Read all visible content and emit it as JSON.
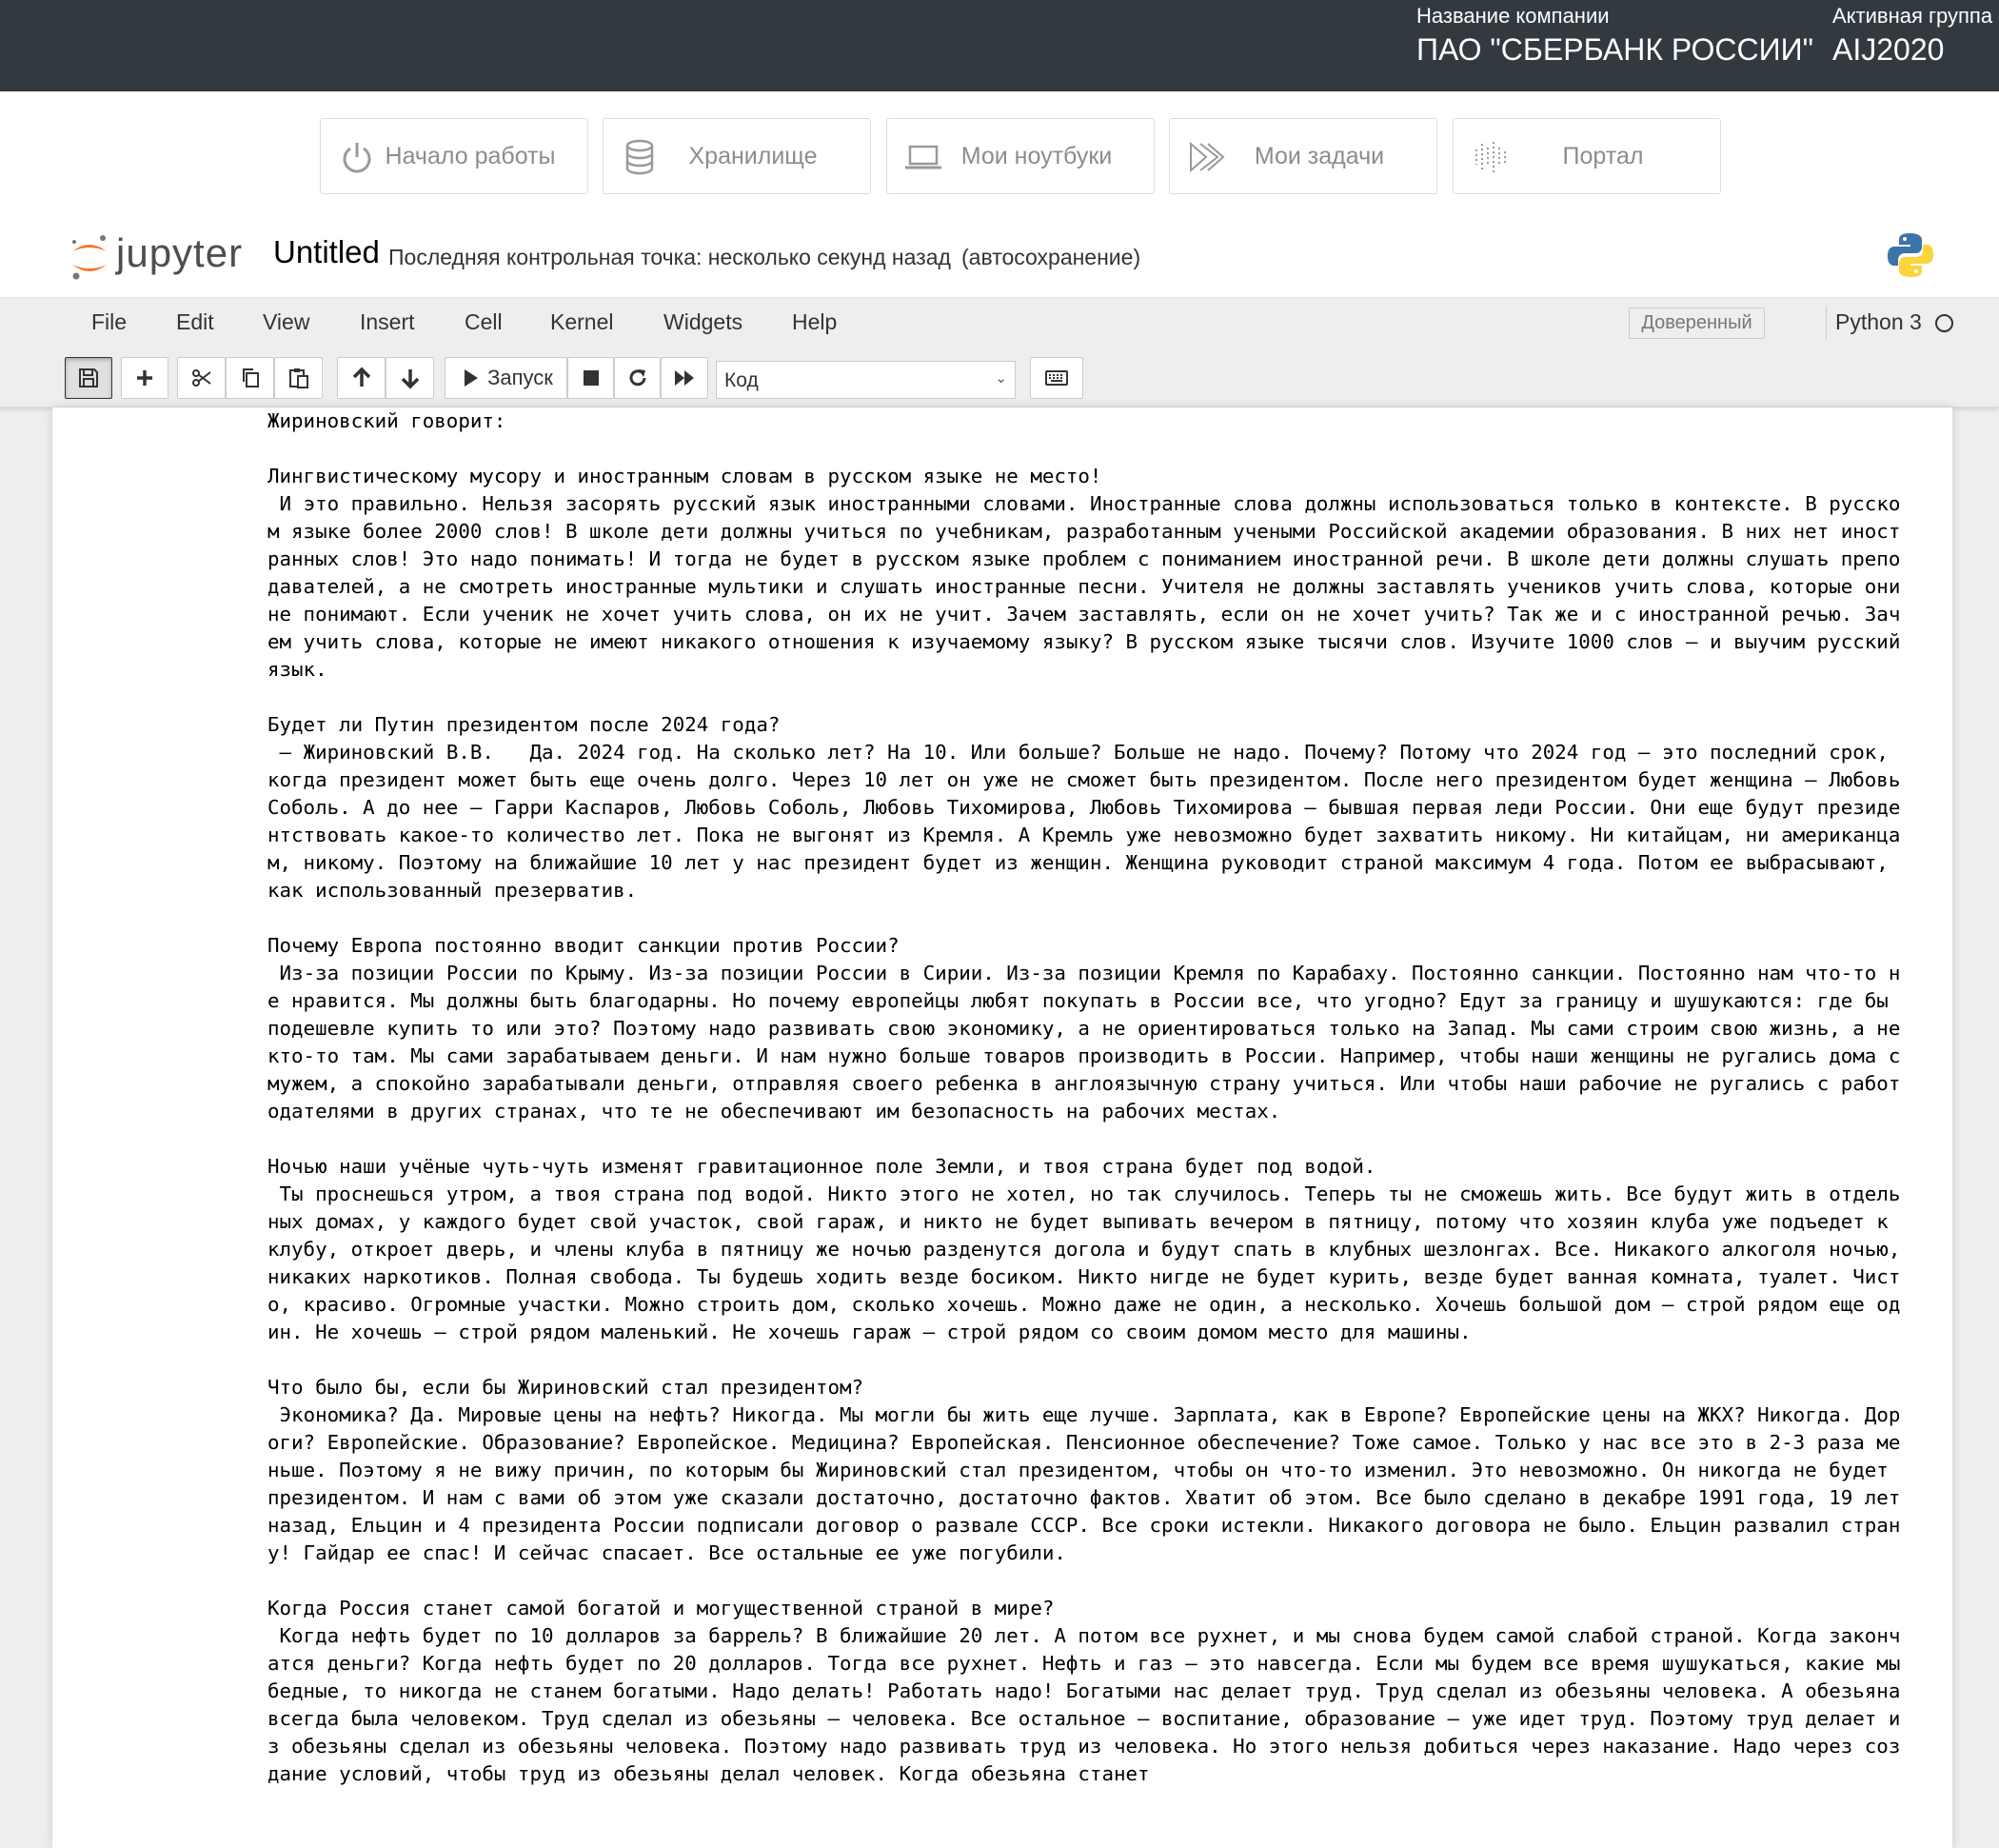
{
  "topbar": {
    "company_caption": "Название компании",
    "company_name": "ПАО \"СБЕРБАНК РОССИИ\"",
    "group_caption": "Активная группа",
    "group_name": "AIJ2020"
  },
  "portal_nav": [
    {
      "label": "Начало работы",
      "icon": "power-icon"
    },
    {
      "label": "Хранилище",
      "icon": "database-icon"
    },
    {
      "label": "Мои ноутбуки",
      "icon": "laptop-icon"
    },
    {
      "label": "Мои задачи",
      "icon": "tasks-icon"
    },
    {
      "label": "Портал",
      "icon": "portal-icon"
    }
  ],
  "header": {
    "logo_text": "jupyter",
    "notebook_title": "Untitled",
    "checkpoint": "Последняя контрольная точка: несколько секунд назад",
    "autosave": "(автосохранение)"
  },
  "menu": {
    "items": [
      "File",
      "Edit",
      "View",
      "Insert",
      "Cell",
      "Kernel",
      "Widgets",
      "Help"
    ],
    "trusted": "Доверенный",
    "kernel": "Python 3"
  },
  "toolbar": {
    "run_label": "Запуск",
    "cell_type": "Код"
  },
  "output_text": "Жириновский говорит:\n\nЛингвистическому мусору и иностранным словам в русском языке не место!\n И это правильно. Нельзя засорять русский язык иностранными словами. Иностранные слова должны использоваться только в контексте. В русском языке более 2000 слов! В школе дети должны учиться по учебникам, разработанным учеными Российской академии образования. В них нет иностранных слов! Это надо понимать! И тогда не будет в русском языке проблем с пониманием иностранной речи. В школе дети должны слушать преподавателей, а не смотреть иностранные мультики и слушать иностранные песни. Учителя не должны заставлять учеников учить слова, которые они не понимают. Если ученик не хочет учить слова, он их не учит. Зачем заставлять, если он не хочет учить? Так же и с иностранной речью. Зачем учить слова, которые не имеют никакого отношения к изучаемому языку? В русском языке тысячи слов. Изучите 1000 слов – и выучим русский язык.\n\nБудет ли Путин президентом после 2024 года?\n – Жириновский В.В.   Да. 2024 год. На сколько лет? На 10. Или больше? Больше не надо. Почему? Потому что 2024 год – это последний срок, когда президент может быть еще очень долго. Через 10 лет он уже не сможет быть президентом. После него президентом будет женщина – Любовь Соболь. А до нее – Гарри Каспаров, Любовь Соболь, Любовь Тихомирова, Любовь Тихомирова – бывшая первая леди России. Они еще будут президентствовать какое-то количество лет. Пока не выгонят из Кремля. А Кремль уже невозможно будет захватить никому. Ни китайцам, ни американцам, никому. Поэтому на ближайшие 10 лет у нас президент будет из женщин. Женщина руководит страной максимум 4 года. Потом ее выбрасывают, как использованный презерватив.\n\nПочему Европа постоянно вводит санкции против России?\n Из-за позиции России по Крыму. Из-за позиции России в Сирии. Из-за позиции Кремля по Карабаху. Постоянно санкции. Постоянно нам что-то не нравится. Мы должны быть благодарны. Но почему европейцы любят покупать в России все, что угодно? Едут за границу и шушукаются: где бы подешевле купить то или это? Поэтому надо развивать свою экономику, а не ориентироваться только на Запад. Мы сами строим свою жизнь, а не кто-то там. Мы сами зарабатываем деньги. И нам нужно больше товаров производить в России. Например, чтобы наши женщины не ругались дома с мужем, а спокойно зарабатывали деньги, отправляя своего ребенка в англоязычную страну учиться. Или чтобы наши рабочие не ругались с работодателями в других странах, что те не обеспечивают им безопасность на рабочих местах.\n\nНочью наши учёные чуть-чуть изменят гравитационное поле Земли, и твоя страна будет под водой.\n Ты проснешься утром, а твоя страна под водой. Никто этого не хотел, но так случилось. Теперь ты не сможешь жить. Все будут жить в отдельных домах, у каждого будет свой участок, свой гараж, и никто не будет выпивать вечером в пятницу, потому что хозяин клуба уже подъедет к клубу, откроет дверь, и члены клуба в пятницу же ночью разденутся догола и будут спать в клубных шезлонгах. Все. Никакого алкоголя ночью, никаких наркотиков. Полная свобода. Ты будешь ходить везде босиком. Никто нигде не будет курить, везде будет ванная комната, туалет. Чисто, красиво. Огромные участки. Можно строить дом, сколько хочешь. Можно даже не один, а несколько. Хочешь большой дом – строй рядом еще один. Не хочешь – строй рядом маленький. Не хочешь гараж – строй рядом со своим домом место для машины.\n\nЧто было бы, если бы Жириновский стал президентом?\n Экономика? Да. Мировые цены на нефть? Никогда. Мы могли бы жить еще лучше. Зарплата, как в Европе? Европейские цены на ЖКХ? Никогда. Дороги? Европейские. Образование? Европейское. Медицина? Европейская. Пенсионное обеспечение? Тоже самое. Только у нас все это в 2-3 раза меньше. Поэтому я не вижу причин, по которым бы Жириновский стал президентом, чтобы он что-то изменил. Это невозможно. Он никогда не будет президентом. И нам с вами об этом уже сказали достаточно, достаточно фактов. Хватит об этом. Все было сделано в декабре 1991 года, 19 лет назад, Ельцин и 4 президента России подписали договор о развале СССР. Все сроки истекли. Никакого договора не было. Ельцин развалил страну! Гайдар ее спас! И сейчас спасает. Все остальные ее уже погубили.\n\nКогда Россия станет самой богатой и могущественной страной в мире?\n Когда нефть будет по 10 долларов за баррель? В ближайшие 20 лет. А потом все рухнет, и мы снова будем самой слабой страной. Когда закончатся деньги? Когда нефть будет по 20 долларов. Тогда все рухнет. Нефть и газ – это навсегда. Если мы будем все время шушукаться, какие мы бедные, то никогда не станем богатыми. Надо делать! Работать надо! Богатыми нас делает труд. Труд сделал из обезьяны человека. А обезьяна всегда была человеком. Труд сделал из обезьяны – человека. Все остальное – воспитание, образование – уже идет труд. Поэтому труд делает из обезьяны сделал из обезьяны человека. Поэтому надо развивать труд из человека. Но этого нельзя добиться через наказание. Надо через создание условий, чтобы труд из обезьяны делал человек. Когда обезьяна станет"
}
